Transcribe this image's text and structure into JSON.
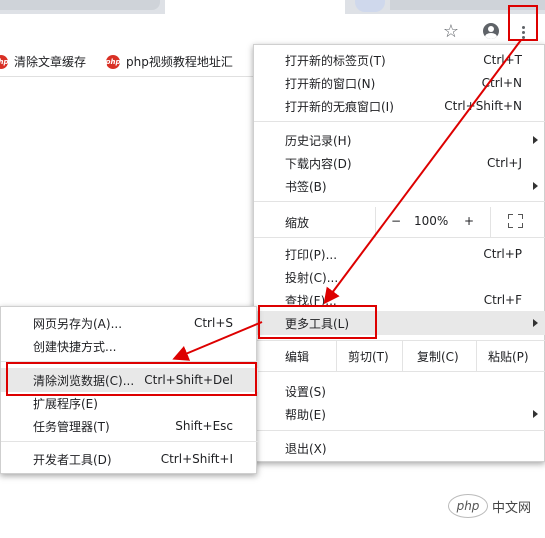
{
  "bookmarks": [
    {
      "label": "清除文章缓存",
      "icon": "php"
    },
    {
      "label": "php视频教程地址汇",
      "icon": "php"
    }
  ],
  "main_menu": {
    "new_tab": {
      "label": "打开新的标签页(T)",
      "shortcut": "Ctrl+T"
    },
    "new_window": {
      "label": "打开新的窗口(N)",
      "shortcut": "Ctrl+N"
    },
    "incognito": {
      "label": "打开新的无痕窗口(I)",
      "shortcut": "Ctrl+Shift+N"
    },
    "history": {
      "label": "历史记录(H)"
    },
    "downloads": {
      "label": "下载内容(D)",
      "shortcut": "Ctrl+J"
    },
    "bookmarks": {
      "label": "书签(B)"
    },
    "zoom": {
      "label": "缩放",
      "minus": "−",
      "value": "100%",
      "plus": "+"
    },
    "print": {
      "label": "打印(P)...",
      "shortcut": "Ctrl+P"
    },
    "cast": {
      "label": "投射(C)..."
    },
    "find": {
      "label": "查找(F)...",
      "shortcut": "Ctrl+F"
    },
    "more_tools": {
      "label": "更多工具(L)"
    },
    "edit": {
      "label": "编辑",
      "cut": "剪切(T)",
      "copy": "复制(C)",
      "paste": "粘贴(P)"
    },
    "settings": {
      "label": "设置(S)"
    },
    "help": {
      "label": "帮助(E)"
    },
    "exit": {
      "label": "退出(X)"
    }
  },
  "sub_menu": {
    "save_page": {
      "label": "网页另存为(A)...",
      "shortcut": "Ctrl+S"
    },
    "create_shortcut": {
      "label": "创建快捷方式..."
    },
    "clear_data": {
      "label": "清除浏览数据(C)...",
      "shortcut": "Ctrl+Shift+Del"
    },
    "extensions": {
      "label": "扩展程序(E)"
    },
    "task_manager": {
      "label": "任务管理器(T)",
      "shortcut": "Shift+Esc"
    },
    "dev_tools": {
      "label": "开发者工具(D)",
      "shortcut": "Ctrl+Shift+I"
    }
  },
  "watermark": {
    "logo": "php",
    "text": "中文网"
  },
  "colors": {
    "highlight_red": "#d00000",
    "menu_hover": "#e8e8e8"
  }
}
